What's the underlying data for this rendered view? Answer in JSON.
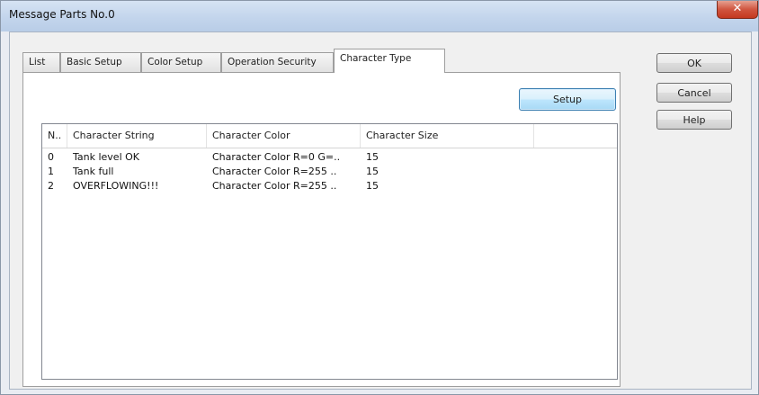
{
  "window": {
    "title": "Message Parts No.0",
    "close_glyph": "✕"
  },
  "tabs": [
    {
      "label": "List"
    },
    {
      "label": "Basic Setup"
    },
    {
      "label": "Color Setup"
    },
    {
      "label": "Operation Security"
    },
    {
      "label": "Character Type",
      "active": true
    }
  ],
  "panel": {
    "setup_label": "Setup"
  },
  "table": {
    "columns": [
      "N..",
      "Character String",
      "Character Color",
      "Character Size"
    ],
    "rows": [
      {
        "n": "0",
        "string": "Tank level OK",
        "color": "Character Color R=0 G=..",
        "size": "15"
      },
      {
        "n": "1",
        "string": "Tank full",
        "color": "Character Color R=255 ..",
        "size": "15"
      },
      {
        "n": "2",
        "string": "OVERFLOWING!!!",
        "color": "Character Color R=255 ..",
        "size": "15"
      }
    ]
  },
  "buttons": {
    "ok": "OK",
    "cancel": "Cancel",
    "help": "Help"
  },
  "colors": {
    "accent_button": "#a7d9f5",
    "close_button": "#c4381f"
  }
}
